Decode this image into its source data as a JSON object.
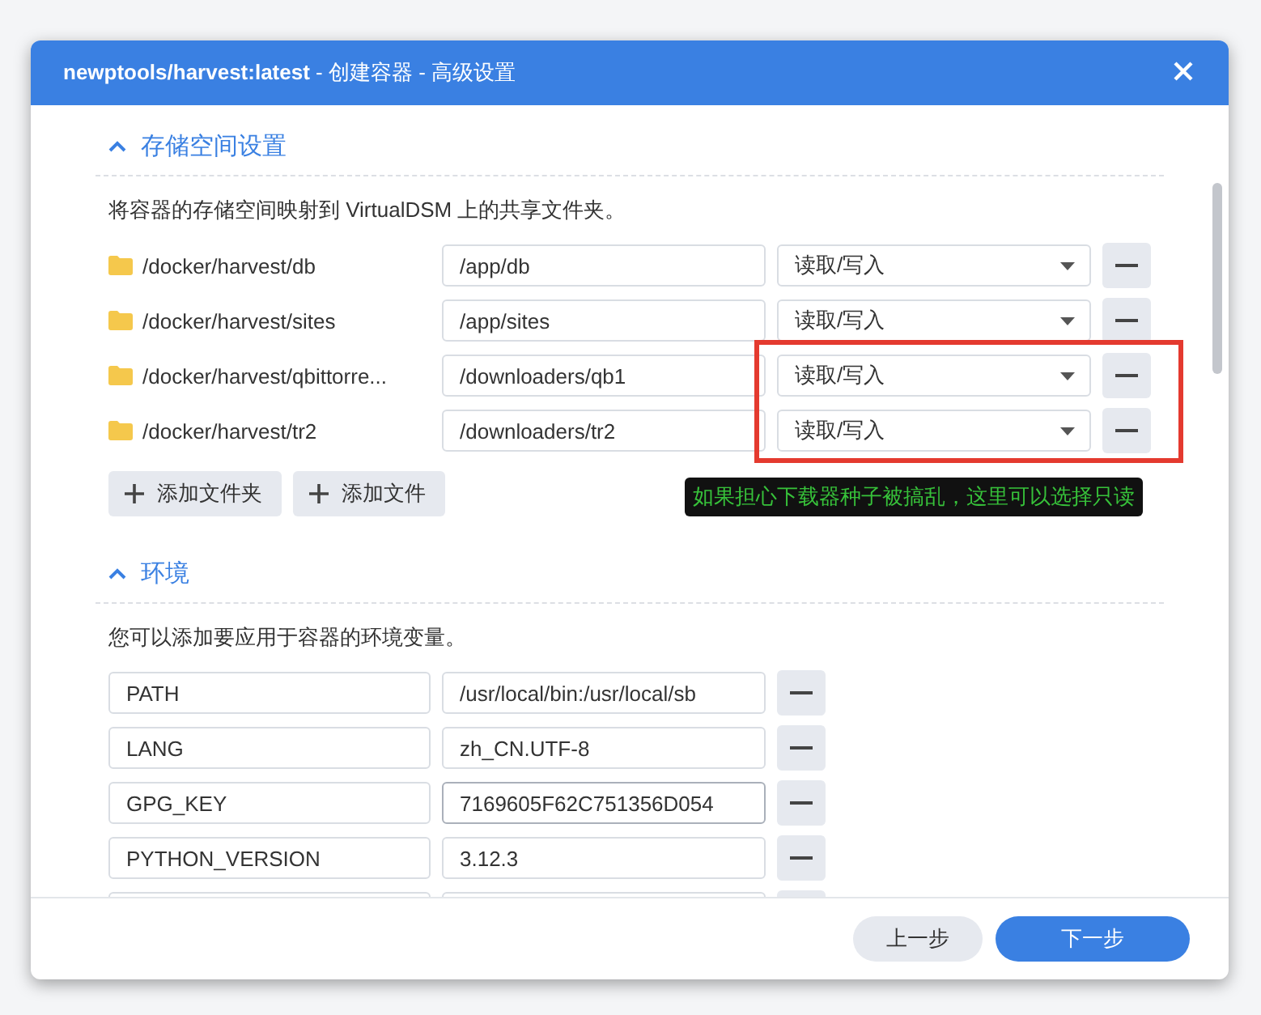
{
  "window": {
    "title_main": "newptools/harvest:latest",
    "title_rest": " - 创建容器 - 高级设置"
  },
  "storage": {
    "title": "存储空间设置",
    "expanded": true,
    "description": "将容器的存储空间映射到 VirtualDSM 上的共享文件夹。",
    "volumes": [
      {
        "host": "/docker/harvest/db",
        "container": "/app/db",
        "mode": "读取/写入",
        "highlighted": false
      },
      {
        "host": "/docker/harvest/sites",
        "container": "/app/sites",
        "mode": "读取/写入",
        "highlighted": false
      },
      {
        "host": "/docker/harvest/qbittorre...",
        "container": "/downloaders/qb1",
        "mode": "读取/写入",
        "highlighted": true
      },
      {
        "host": "/docker/harvest/tr2",
        "container": "/downloaders/tr2",
        "mode": "读取/写入",
        "highlighted": true
      }
    ],
    "buttons": [
      "添加文件夹",
      "添加文件"
    ],
    "annotation": "如果担心下载器种子被搞乱，这里可以选择只读"
  },
  "environment": {
    "title": "环境",
    "expanded": true,
    "description": "您可以添加要应用于容器的环境变量。",
    "variables": [
      {
        "key": "PATH",
        "value": "/usr/local/bin:/usr/local/sb",
        "focused": false
      },
      {
        "key": "LANG",
        "value": "zh_CN.UTF-8",
        "focused": false
      },
      {
        "key": "GPG_KEY",
        "value": "7169605F62C751356D054",
        "focused": true
      },
      {
        "key": "PYTHON_VERSION",
        "value": "3.12.3",
        "focused": false
      }
    ]
  },
  "footer": {
    "back": "上一步",
    "next": "下一步"
  }
}
